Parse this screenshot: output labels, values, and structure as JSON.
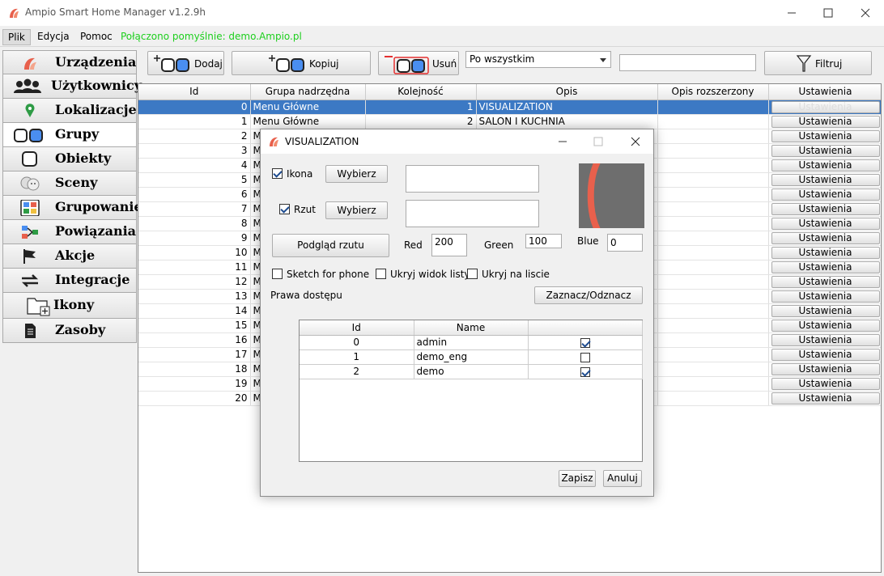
{
  "window": {
    "title": "Ampio Smart Home Manager v1.2.9h"
  },
  "menu": {
    "items": [
      "Plik",
      "Edycja",
      "Pomoc"
    ],
    "status": "Połączono pomyślnie: demo.Ampio.pl",
    "status_color": "#1dcf1d"
  },
  "sidebar": {
    "items": [
      {
        "label": "Urządzenia",
        "icon": "device-icon"
      },
      {
        "label": "Użytkownicy",
        "icon": "users-icon"
      },
      {
        "label": "Lokalizacje",
        "icon": "location-pin-icon"
      },
      {
        "label": "Grupy",
        "icon": "groups-icon"
      },
      {
        "label": "Obiekty",
        "icon": "object-icon"
      },
      {
        "label": "Sceny",
        "icon": "scenes-masks-icon"
      },
      {
        "label": "Grupowanie",
        "icon": "grouping-icon"
      },
      {
        "label": "Powiązania",
        "icon": "links-icon"
      },
      {
        "label": "Akcje",
        "icon": "flag-icon"
      },
      {
        "label": "Integracje",
        "icon": "arrows-icon"
      },
      {
        "label": "Ikony",
        "icon": "folder-add-icon"
      },
      {
        "label": "Zasoby",
        "icon": "document-icon"
      }
    ],
    "active": "Grupy"
  },
  "toolbar": {
    "add_label": "Dodaj",
    "copy_label": "Kopiuj",
    "delete_label": "Usuń",
    "filter_mode": "Po wszystkim",
    "filter_value": "",
    "filter_label": "Filtruj"
  },
  "table": {
    "columns": [
      "Id",
      "Grupa nadrzędna",
      "Kolejność",
      "Opis",
      "Opis rozszerzony",
      "Ustawienia"
    ],
    "button_label": "Ustawienia",
    "rows": [
      {
        "id": "0",
        "parent": "Menu Główne",
        "order": "1",
        "desc": "VISUALIZATION",
        "ext": "",
        "selected": true
      },
      {
        "id": "1",
        "parent": "Menu Główne",
        "order": "2",
        "desc": "SALON I KUCHNIA",
        "ext": ""
      },
      {
        "id": "2",
        "parent": "Me",
        "order": "",
        "desc": "",
        "ext": ""
      },
      {
        "id": "3",
        "parent": "Me",
        "order": "",
        "desc": "",
        "ext": ""
      },
      {
        "id": "4",
        "parent": "Me",
        "order": "",
        "desc": "",
        "ext": ""
      },
      {
        "id": "5",
        "parent": "Me",
        "order": "",
        "desc": "",
        "ext": ""
      },
      {
        "id": "6",
        "parent": "Me",
        "order": "",
        "desc": "",
        "ext": ""
      },
      {
        "id": "7",
        "parent": "Me",
        "order": "",
        "desc": "",
        "ext": ""
      },
      {
        "id": "8",
        "parent": "Me",
        "order": "",
        "desc": "",
        "ext": ""
      },
      {
        "id": "9",
        "parent": "Me",
        "order": "",
        "desc": "",
        "ext": ""
      },
      {
        "id": "10",
        "parent": "Me",
        "order": "",
        "desc": "",
        "ext": ""
      },
      {
        "id": "11",
        "parent": "Me",
        "order": "",
        "desc": "",
        "ext": ""
      },
      {
        "id": "12",
        "parent": "Me",
        "order": "",
        "desc": "",
        "ext": ""
      },
      {
        "id": "13",
        "parent": "Me",
        "order": "",
        "desc": "",
        "ext": ""
      },
      {
        "id": "14",
        "parent": "Me",
        "order": "",
        "desc": "",
        "ext": ""
      },
      {
        "id": "15",
        "parent": "Me",
        "order": "",
        "desc": "",
        "ext": ""
      },
      {
        "id": "16",
        "parent": "Me",
        "order": "",
        "desc": "",
        "ext": ""
      },
      {
        "id": "17",
        "parent": "Me",
        "order": "",
        "desc": "",
        "ext": ""
      },
      {
        "id": "18",
        "parent": "Me",
        "order": "",
        "desc": "",
        "ext": ""
      },
      {
        "id": "19",
        "parent": "Me",
        "order": "",
        "desc": "",
        "ext": ""
      },
      {
        "id": "20",
        "parent": "Me",
        "order": "",
        "desc": "",
        "ext": ""
      }
    ]
  },
  "dialog": {
    "title": "VISUALIZATION",
    "icon_label": "Ikona",
    "icon_checked": true,
    "plan_label": "Rzut",
    "plan_checked": true,
    "choose_label": "Wybierz",
    "icon_path": "",
    "plan_path": "",
    "preview_button": "Podgląd rzutu",
    "red_label": "Red",
    "red_value": "200",
    "green_label": "Green",
    "green_value": "100",
    "blue_label": "Blue",
    "blue_value": "0",
    "preview_color": "#c86400",
    "sketch_label": "Sketch for phone",
    "hide_list_label": "Ukryj widok listy",
    "hide_on_list_label": "Ukryj na liscie",
    "access_label": "Prawa dostępu",
    "toggle_label": "Zaznacz/Odznacz",
    "access_columns": [
      "Id",
      "Name",
      ""
    ],
    "access_rows": [
      {
        "id": "0",
        "name": "admin",
        "checked": true
      },
      {
        "id": "1",
        "name": "demo_eng",
        "checked": false
      },
      {
        "id": "2",
        "name": "demo",
        "checked": true
      }
    ],
    "save_label": "Zapisz",
    "cancel_label": "Anuluj"
  }
}
